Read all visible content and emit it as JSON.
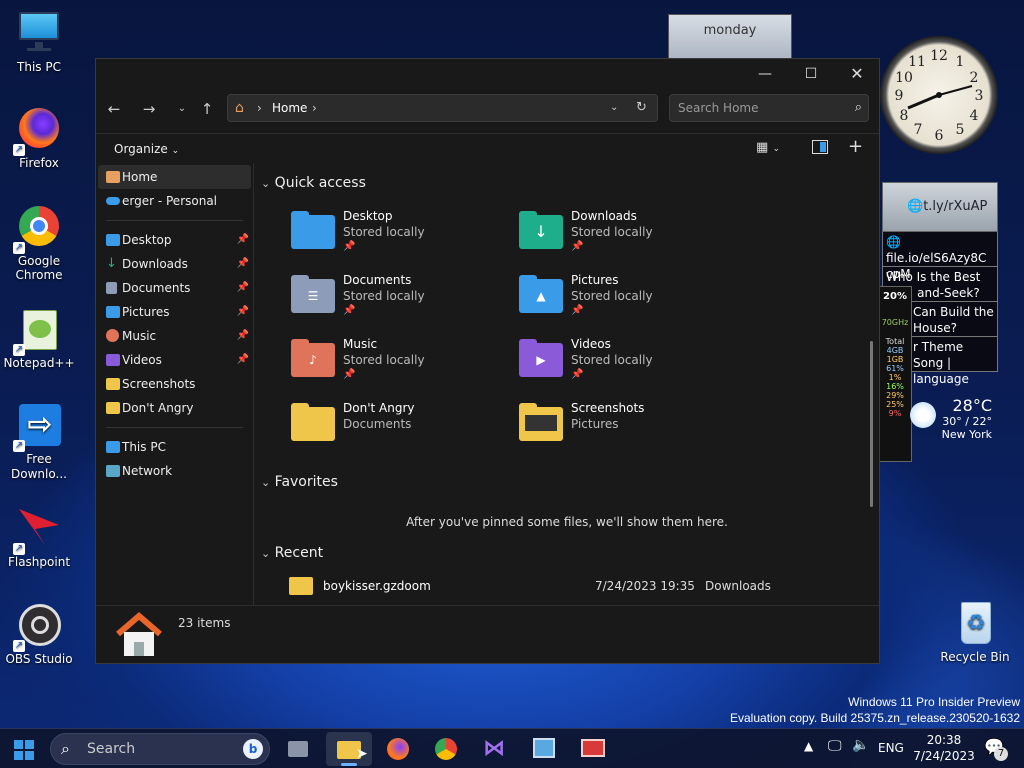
{
  "desktop": {
    "icons": [
      {
        "label": "This PC"
      },
      {
        "label": "Firefox"
      },
      {
        "label": "Google Chrome"
      },
      {
        "label": "Notepad++"
      },
      {
        "label": "Free Downlo..."
      },
      {
        "label": "Flashpoint"
      },
      {
        "label": "OBS Studio"
      }
    ],
    "recycle_bin": "Recycle Bin",
    "watermark_line1": "Windows 11 Pro Insider Preview",
    "watermark_line2": "Evaluation copy. Build 25375.zn_release.230520-1632"
  },
  "widgets": {
    "calendar_day": "monday",
    "links": [
      "t.ly/rXuAP",
      "file.io/elS6Azy8C cpM",
      "Who Is the Best at ... and-Seek?",
      "Can Build the House?",
      "r Theme Song | language"
    ],
    "meter": {
      "cpu": "20%",
      "freq": "70GHz",
      "total_label": "Total",
      "rows": [
        "4GB",
        "1GB",
        "61%",
        "1%",
        "16%",
        "29%",
        "25%",
        "9%"
      ]
    },
    "weather": {
      "temp": "28°C",
      "range": "30° / 22°",
      "city": "New York"
    }
  },
  "explorer": {
    "breadcrumb": "Home",
    "search_placeholder": "Search Home",
    "toolbar": {
      "organize": "Organize"
    },
    "sidebar": {
      "home": "Home",
      "onedrive": "erger - Personal",
      "pinned": [
        "Desktop",
        "Downloads",
        "Documents",
        "Pictures",
        "Music",
        "Videos"
      ],
      "folders": [
        "Screenshots",
        "Don't Angry"
      ],
      "this_pc": "This PC",
      "network": "Network"
    },
    "quick_access": {
      "title": "Quick access",
      "items": [
        {
          "name": "Desktop",
          "sub": "Stored locally",
          "color": "#3a9be8"
        },
        {
          "name": "Downloads",
          "sub": "Stored locally",
          "color": "#1fae8c"
        },
        {
          "name": "Documents",
          "sub": "Stored locally",
          "color": "#8d9cb8"
        },
        {
          "name": "Pictures",
          "sub": "Stored locally",
          "color": "#3a9be8"
        },
        {
          "name": "Music",
          "sub": "Stored locally",
          "color": "#e0745a"
        },
        {
          "name": "Videos",
          "sub": "Stored locally",
          "color": "#8a5ad8"
        },
        {
          "name": "Don't Angry",
          "sub": "Documents",
          "color": "#f0c64a"
        },
        {
          "name": "Screenshots",
          "sub": "Pictures",
          "color": "#f0c64a"
        }
      ]
    },
    "favorites": {
      "title": "Favorites",
      "empty": "After you've pinned some files, we'll show them here."
    },
    "recent": {
      "title": "Recent",
      "rows": [
        {
          "name": "boykisser.gzdoom",
          "date": "7/24/2023 19:35",
          "location": "Downloads"
        }
      ]
    },
    "status": {
      "count": "23 items"
    }
  },
  "taskbar": {
    "search": "Search",
    "lang": "ENG",
    "time": "20:38",
    "date": "7/24/2023",
    "notifications": "7"
  }
}
